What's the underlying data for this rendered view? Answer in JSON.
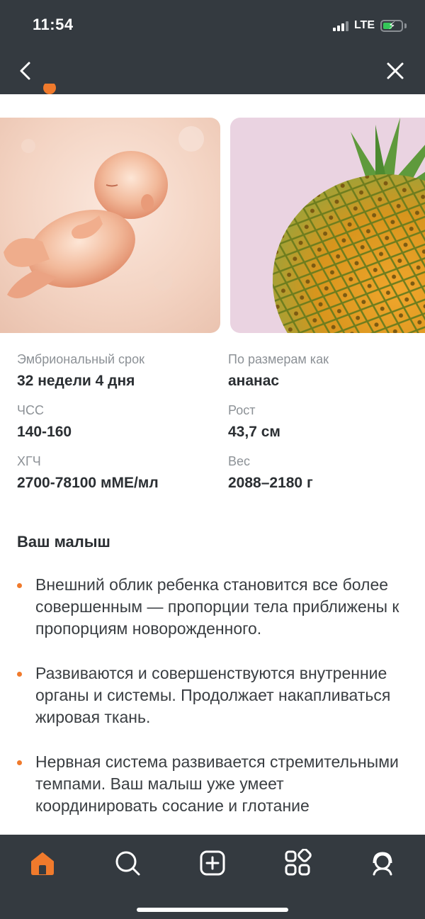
{
  "status_bar": {
    "time": "11:54",
    "network": "LTE",
    "battery_state": "charging"
  },
  "header": {
    "back_icon": "chevron-left-icon",
    "close_icon": "close-icon"
  },
  "images": [
    {
      "name": "embryo-image",
      "subject": "embryo"
    },
    {
      "name": "pineapple-image",
      "subject": "pineapple"
    }
  ],
  "stats": {
    "embryo_term": {
      "label": "Эмбриональный срок",
      "value": "32 недели 4 дня"
    },
    "size_like": {
      "label": "По размерам как",
      "value": "ананас"
    },
    "heart_rate": {
      "label": "ЧСС",
      "value": "140-160"
    },
    "height": {
      "label": "Рост",
      "value": "43,7 см"
    },
    "hcg": {
      "label": "ХГЧ",
      "value": "2700-78100 мМЕ/мл"
    },
    "weight": {
      "label": "Вес",
      "value": "2088–2180 г"
    }
  },
  "section": {
    "title": "Ваш малыш",
    "bullets": [
      "Внешний облик ребенка становится все более совершенным — пропорции тела приближены к пропорциям новорожденного.",
      "Развиваются и совершенствуются внутренние органы и системы. Продолжает накапливаться жировая ткань.",
      "Нервная система развивается стремительными темпами. Ваш малыш уже умеет координировать сосание и глотание"
    ]
  },
  "tabbar": {
    "items": [
      {
        "name": "tab-home",
        "icon": "home-icon",
        "active": true
      },
      {
        "name": "tab-search",
        "icon": "search-icon",
        "active": false
      },
      {
        "name": "tab-create",
        "icon": "add-square-icon",
        "active": false
      },
      {
        "name": "tab-services",
        "icon": "grid-icon",
        "active": false
      },
      {
        "name": "tab-profile",
        "icon": "profile-icon",
        "active": false
      }
    ]
  },
  "colors": {
    "header_bg": "#343a40",
    "accent": "#f07a2c",
    "label_gray": "#8c9196"
  }
}
